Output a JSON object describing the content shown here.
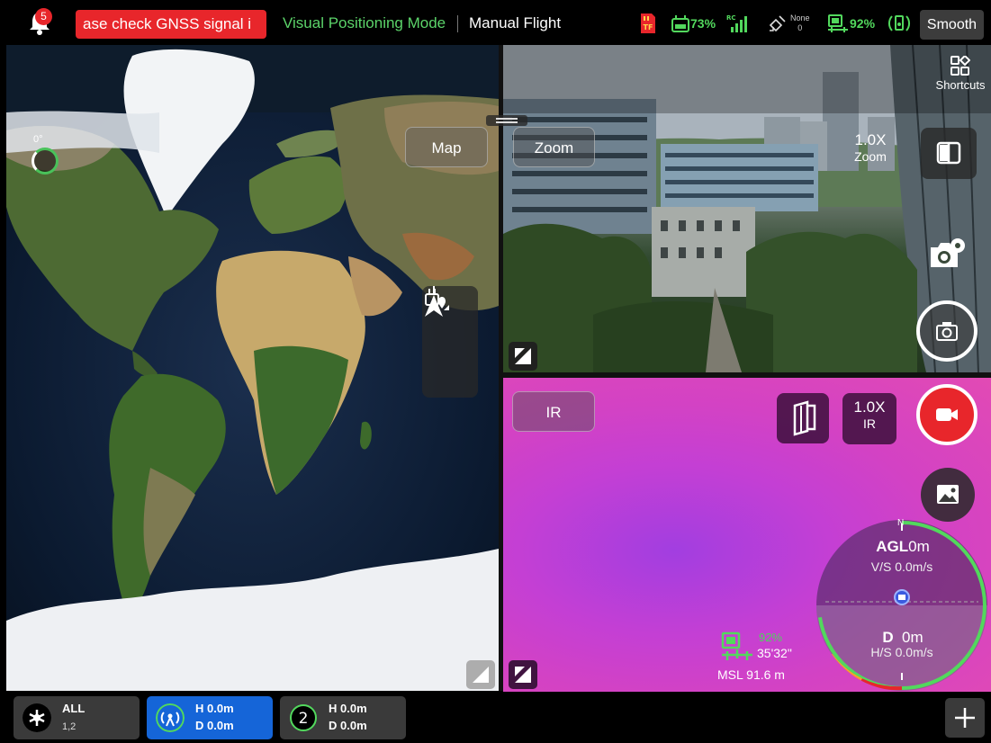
{
  "topbar": {
    "notification_count": "5",
    "alert_text": "ase check GNSS signal i",
    "positioning_mode": "Visual Positioning Mode",
    "flight_mode": "Manual Flight",
    "sd_label": "TF",
    "rc_battery": "73%",
    "rc_signal_label": "RC",
    "gnss_label": "None",
    "gnss_count": "0",
    "aircraft_battery": "92%",
    "smooth_label": "Smooth"
  },
  "map": {
    "heading": "0°",
    "map_button": "Map"
  },
  "zoom_camera": {
    "label": "Zoom",
    "factor": "1.0X",
    "factor_unit": "Zoom",
    "shortcuts_label": "Shortcuts"
  },
  "ir_camera": {
    "label": "IR",
    "factor": "1.0X",
    "factor_unit": "IR"
  },
  "attitude": {
    "north": "N",
    "agl_label": "AGL",
    "agl_value": "0m",
    "vs": "V/S 0.0m/s",
    "d_label": "D",
    "d_value": "0m",
    "hs": "H/S 0.0m/s"
  },
  "aircraft_status": {
    "battery": "92%",
    "flight_time": "35'32\"",
    "msl": "MSL 91.6 m"
  },
  "devices": [
    {
      "title": "ALL",
      "subtitle": "1,2"
    },
    {
      "title": "H 0.0m",
      "subtitle": "D 0.0m"
    },
    {
      "badge": "2",
      "title": "H 0.0m",
      "subtitle": "D 0.0m"
    }
  ],
  "colors": {
    "alert_red": "#e8262b",
    "status_green": "#52d85d",
    "active_device_blue": "#1565d8"
  },
  "icons": [
    "bell-icon",
    "sd-card-icon",
    "rc-battery-icon",
    "rc-signal-icon",
    "satellite-icon",
    "aircraft-battery-icon",
    "hd-signal-icon",
    "shortcuts-icon",
    "split-view-icon",
    "camera-settings-icon",
    "camera-icon",
    "record-icon",
    "gallery-icon",
    "swap-icon",
    "navigation-arrow-icon",
    "rc-location-icon",
    "expand-icon",
    "plus-icon",
    "aircraft-icon"
  ]
}
